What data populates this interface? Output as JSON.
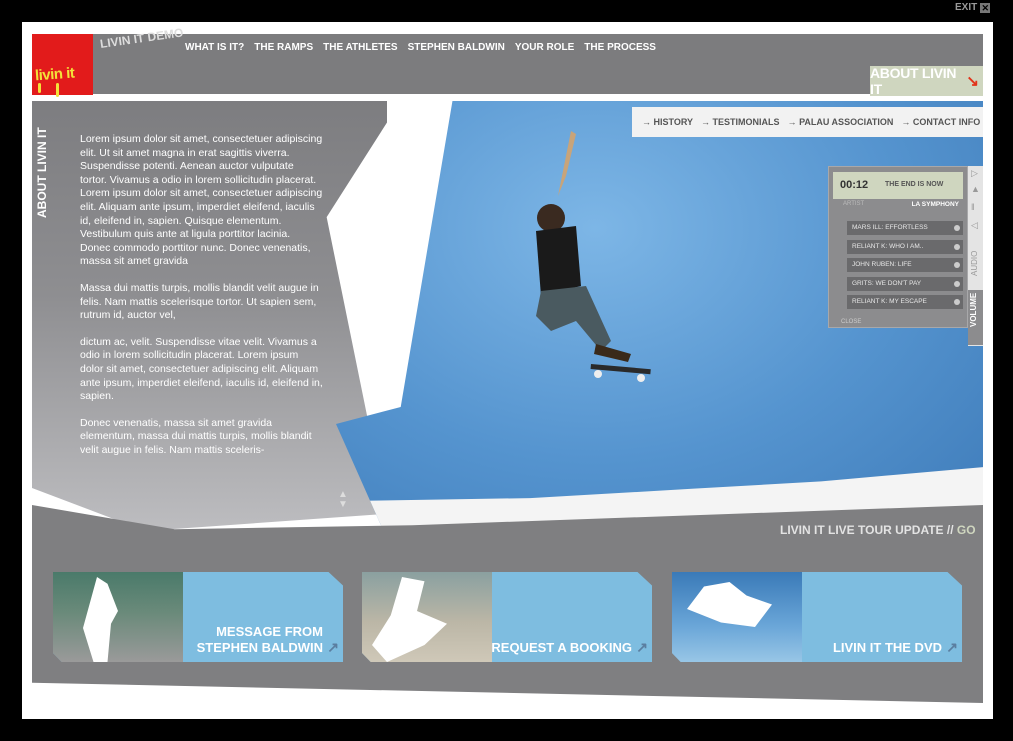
{
  "exit_label": "EXIT",
  "logo_text": "livin it",
  "demo_label": "LIVIN IT DEMO",
  "nav": [
    "WHAT IS IT?",
    "THE RAMPS",
    "THE ATHLETES",
    "STEPHEN BALDWIN",
    "YOUR ROLE",
    "THE PROCESS"
  ],
  "about_button": "ABOUT LIVIN IT",
  "side_title": "ABOUT LIVIN IT",
  "body_paragraphs": [
    "Lorem ipsum dolor sit amet, consectetuer adipiscing elit. Ut sit amet magna in erat sagittis viverra. Suspendisse potenti. Aenean auctor vulputate tortor. Vivamus a odio in lorem sollicitudin placerat. Lorem ipsum dolor sit amet, consectetuer adipiscing elit. Aliquam ante ipsum, imperdiet eleifend, iaculis id, eleifend in, sapien. Quisque elementum. Vestibulum quis ante at ligula porttitor lacinia. Donec commodo porttitor nunc. Donec venenatis, massa sit amet gravida",
    "Massa dui mattis turpis, mollis blandit velit augue in felis. Nam mattis scelerisque tortor. Ut sapien sem, rutrum id, auctor vel,",
    "dictum ac, velit. Suspendisse vitae velit. Vivamus a odio in lorem sollicitudin placerat. Lorem ipsum dolor sit amet, consectetuer adipiscing elit. Aliquam ante ipsum, imperdiet eleifend, iaculis id, eleifend in, sapien.",
    "Donec venenatis, massa sit amet gravida elementum, massa dui mattis turpis, mollis blandit velit augue in felis. Nam mattis sceleris-"
  ],
  "subnav": [
    "HISTORY",
    "TESTIMONIALS",
    "PALAU ASSOCIATION",
    "CONTACT INFO"
  ],
  "player": {
    "time": "00:12",
    "song": "THE END IS NOW",
    "artist_label": "ARTIST",
    "artist": "LA SYMPHONY",
    "tracks": [
      "MARS ILL: EFFORTLESS",
      "RELIANT K: WHO I AM..",
      "JOHN RUBEN: LIFE",
      "GRITS: WE DON'T PAY",
      "RELIANT K: MY ESCAPE"
    ],
    "close": "CLOSE",
    "audio_label": "AUDIO",
    "volume_label": "VOLUME"
  },
  "tour_update": "LIVIN IT LIVE TOUR UPDATE //",
  "tour_go": "GO",
  "cards": [
    {
      "line1": "MESSAGE FROM",
      "line2": "STEPHEN BALDWIN"
    },
    {
      "line1": "",
      "line2": "REQUEST A BOOKING"
    },
    {
      "line1": "",
      "line2": "LIVIN IT THE DVD"
    }
  ],
  "colors": {
    "accent_green": "#cfd6bf",
    "sky_blue": "#5594cf",
    "card_blue": "#7ebde0",
    "arrow_red": "#e2331a"
  }
}
